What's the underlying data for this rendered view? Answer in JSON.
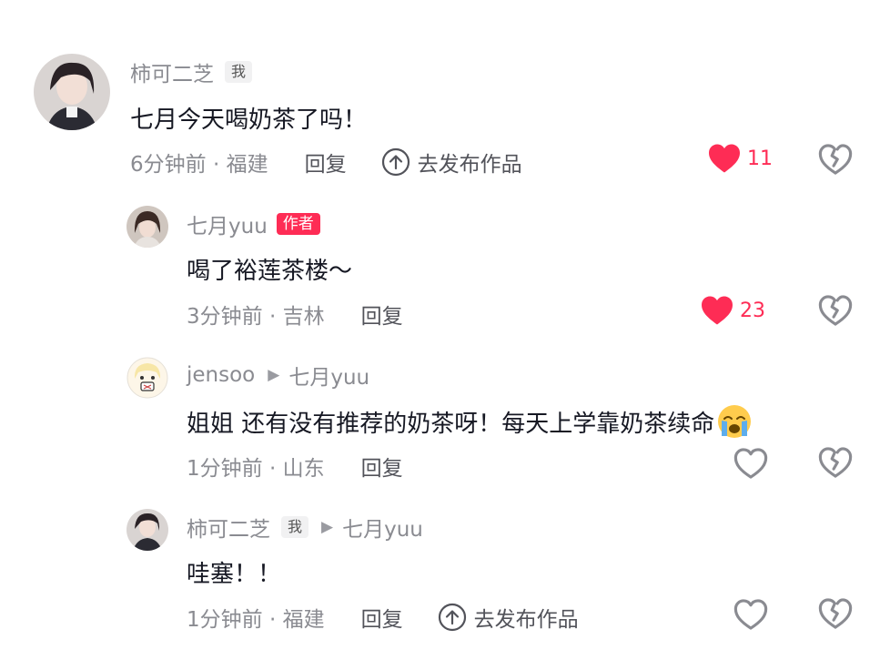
{
  "comments": [
    {
      "username": "柿可二芝",
      "tag": "我",
      "text": "七月今天喝奶茶了吗！",
      "meta": "6分钟前 · 福建",
      "reply_label": "回复",
      "publish_label": "去发布作品",
      "likes": "11",
      "liked": true
    },
    {
      "username": "七月yuu",
      "tag": "作者",
      "text": "喝了裕莲茶楼～",
      "meta": "3分钟前 · 吉林",
      "reply_label": "回复",
      "likes": "23",
      "liked": true
    },
    {
      "username": "jensoo",
      "reply_to": "七月yuu",
      "text": "姐姐 还有没有推荐的奶茶呀！每天上学靠奶茶续命",
      "emoji": "loudly-crying-face",
      "meta": "1分钟前 · 山东",
      "reply_label": "回复",
      "liked": false
    },
    {
      "username": "柿可二芝",
      "tag": "我",
      "reply_to": "七月yuu",
      "text": "哇塞！！",
      "meta": "1分钟前 · 福建",
      "reply_label": "回复",
      "publish_label": "去发布作品",
      "liked": false
    }
  ],
  "colors": {
    "accent": "#fe2c55",
    "secondary_text": "#8a8b91",
    "primary_text": "#161823"
  }
}
